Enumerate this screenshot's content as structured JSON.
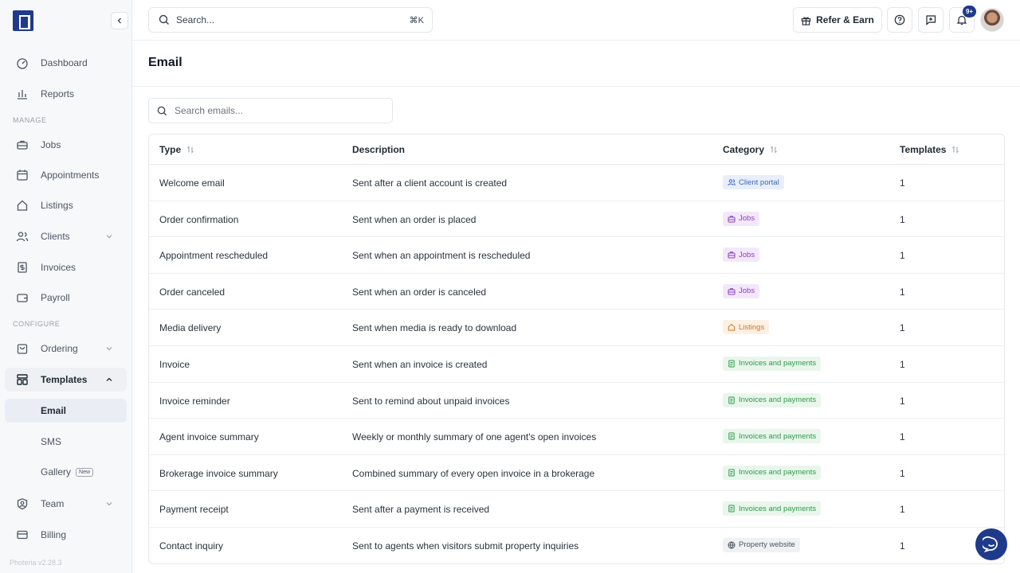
{
  "app": {
    "version": "Photeria v2.28.3"
  },
  "sidebar": {
    "sections": {
      "manage": "MANAGE",
      "configure": "CONFIGURE"
    },
    "items": {
      "dashboard": "Dashboard",
      "reports": "Reports",
      "jobs": "Jobs",
      "appointments": "Appointments",
      "listings": "Listings",
      "clients": "Clients",
      "invoices": "Invoices",
      "payroll": "Payroll",
      "ordering": "Ordering",
      "templates": "Templates",
      "email": "Email",
      "sms": "SMS",
      "gallery": "Gallery",
      "gallery_badge": "New",
      "team": "Team",
      "billing": "Billing"
    }
  },
  "topbar": {
    "search_label": "Search...",
    "search_shortcut": "⌘K",
    "refer_label": "Refer & Earn",
    "notification_count": "9+"
  },
  "page": {
    "title": "Email",
    "search_placeholder": "Search emails..."
  },
  "table": {
    "columns": {
      "type": "Type",
      "description": "Description",
      "category": "Category",
      "templates": "Templates"
    },
    "rows": [
      {
        "type": "Welcome email",
        "description": "Sent after a client account is created",
        "category": "Client portal",
        "category_icon": "users-icon",
        "templates": "1"
      },
      {
        "type": "Order confirmation",
        "description": "Sent when an order is placed",
        "category": "Jobs",
        "category_icon": "briefcase-icon",
        "templates": "1"
      },
      {
        "type": "Appointment rescheduled",
        "description": "Sent when an appointment is rescheduled",
        "category": "Jobs",
        "category_icon": "briefcase-icon",
        "templates": "1"
      },
      {
        "type": "Order canceled",
        "description": "Sent when an order is canceled",
        "category": "Jobs",
        "category_icon": "briefcase-icon",
        "templates": "1"
      },
      {
        "type": "Media delivery",
        "description": "Sent when media is ready to download",
        "category": "Listings",
        "category_icon": "home-icon",
        "templates": "1"
      },
      {
        "type": "Invoice",
        "description": "Sent when an invoice is created",
        "category": "Invoices and payments",
        "category_icon": "invoice-icon",
        "templates": "1"
      },
      {
        "type": "Invoice reminder",
        "description": "Sent to remind about unpaid invoices",
        "category": "Invoices and payments",
        "category_icon": "invoice-icon",
        "templates": "1"
      },
      {
        "type": "Agent invoice summary",
        "description": "Weekly or monthly summary of one agent's open invoices",
        "category": "Invoices and payments",
        "category_icon": "invoice-icon",
        "templates": "1"
      },
      {
        "type": "Brokerage invoice summary",
        "description": "Combined summary of every open invoice in a brokerage",
        "category": "Invoices and payments",
        "category_icon": "invoice-icon",
        "templates": "1"
      },
      {
        "type": "Payment receipt",
        "description": "Sent after a payment is received",
        "category": "Invoices and payments",
        "category_icon": "invoice-icon",
        "templates": "1"
      },
      {
        "type": "Contact inquiry",
        "description": "Sent to agents when visitors submit property inquiries",
        "category": "Property website",
        "category_icon": "globe-icon",
        "templates": "1"
      }
    ]
  },
  "colors": {
    "brand": "#1e3a8a",
    "badge_client_portal": {
      "bg": "#e8effb",
      "fg": "#3b63c4"
    },
    "badge_jobs": {
      "bg": "#f3e8fb",
      "fg": "#8b3fc2"
    },
    "badge_listings": {
      "bg": "#fdf0e4",
      "fg": "#d9731f"
    },
    "badge_invoices": {
      "bg": "#e9f6ec",
      "fg": "#2f9a4a"
    },
    "badge_property": {
      "bg": "#f0f1f3",
      "fg": "#4b5563"
    }
  }
}
